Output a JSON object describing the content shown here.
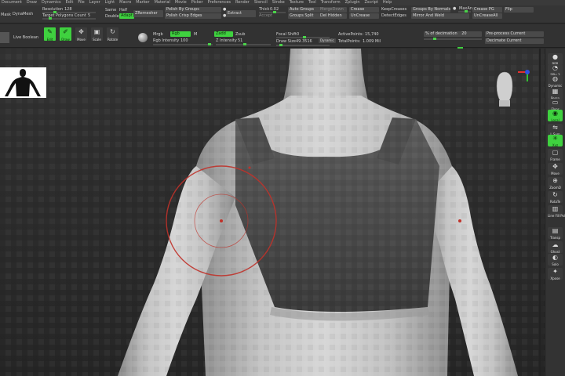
{
  "menu": [
    "Document",
    "Draw",
    "Dynamics",
    "Edit",
    "File",
    "Layer",
    "Light",
    "Macro",
    "Marker",
    "Material",
    "Movie",
    "Picker",
    "Preferences",
    "Render",
    "Stencil",
    "Stroke",
    "Texture",
    "Tool",
    "Transform",
    "Zplugin",
    "Zscript",
    "Help"
  ],
  "geometry": {
    "mask_label": "Mask",
    "dynamesh_label": "DynaMesh",
    "resolution_label": "Resolution",
    "resolution_value": "128",
    "target_polygons_label": "Target Polygons Count",
    "target_polygons_value": "5",
    "same_label": "Same",
    "half_label": "Half",
    "double_label": "Double",
    "adapt_label": "Adapt",
    "zremesher_label": "ZRemesher",
    "polish_groups_label": "Polish By Groups",
    "polish_crisp_label": "Polish Crisp Edges",
    "extract_label": "Extract",
    "thick_label": "Thick",
    "thick_value": "0.02",
    "accept_label": "Accept",
    "auto_groups_label": "Auto Groups",
    "merge_down_label": "MergeDown",
    "groups_split_label": "Groups Split",
    "del_hidden_label": "Del Hidden",
    "crease_label": "Crease",
    "uncrease_label": "UnCrease",
    "keep_creases_label": "KeepCreases",
    "detect_edges_label": "DetectEdges",
    "groups_normals_label": "Groups By Normals",
    "maxan_label": "MaxAn",
    "mirror_weld_label": "Mirror And Weld",
    "crease_pg_label": "Crease PG",
    "uncrease_all_label": "UnCreaseAll",
    "flip_label": "Flip"
  },
  "toolbar": {
    "live_boolean_label": "Live Boolean",
    "edit_label": "Edit",
    "draw_label": "Draw",
    "move_label": "Move",
    "scale_label": "Scale",
    "rotate_label": "Rotate",
    "mrgb_label": "Mrgb",
    "rgb_label": "Rgb",
    "m_label": "M",
    "zadd_label": "Zadd",
    "zsub_label": "Zsub",
    "rgb_intensity_label": "Rgb Intensity",
    "rgb_intensity_value": "100",
    "z_intensity_label": "Z Intensity",
    "z_intensity_value": "51",
    "focal_shift_label": "Focal Shift",
    "focal_shift_value": "0",
    "draw_size_label": "Draw Size",
    "draw_size_value": "49.3516",
    "dynamic_label": "Dynamic",
    "active_points_label": "ActivePoints:",
    "active_points_value": "15,740",
    "total_points_label": "TotalPoints:",
    "total_points_value": "1.009 Mil",
    "decimation_label": "% of decimation",
    "decimation_value": "20",
    "preprocess_label": "Pre-process Current",
    "decimate_label": "Decimate Current"
  },
  "shelf": [
    {
      "label": "BPR"
    },
    {
      "label": "SPix 3"
    },
    {
      "label": "Dynamic"
    },
    {
      "label": "Persp"
    },
    {
      "label": "Floor"
    },
    {
      "label": "Local"
    },
    {
      "label": "L.Sym"
    },
    {
      "label": "Xyz"
    },
    {
      "label": "Frame"
    },
    {
      "label": "Move"
    },
    {
      "label": "ZoomD"
    },
    {
      "label": "RotaTe"
    },
    {
      "label": "Line Fill PolyF"
    },
    {
      "label": "Transp"
    },
    {
      "label": "Ghost"
    },
    {
      "label": "Solo"
    },
    {
      "label": "Xpose"
    }
  ],
  "colors": {
    "accent": "#3fd13f",
    "brush_ring": "#c0322a",
    "background": "#2e2e2e"
  }
}
